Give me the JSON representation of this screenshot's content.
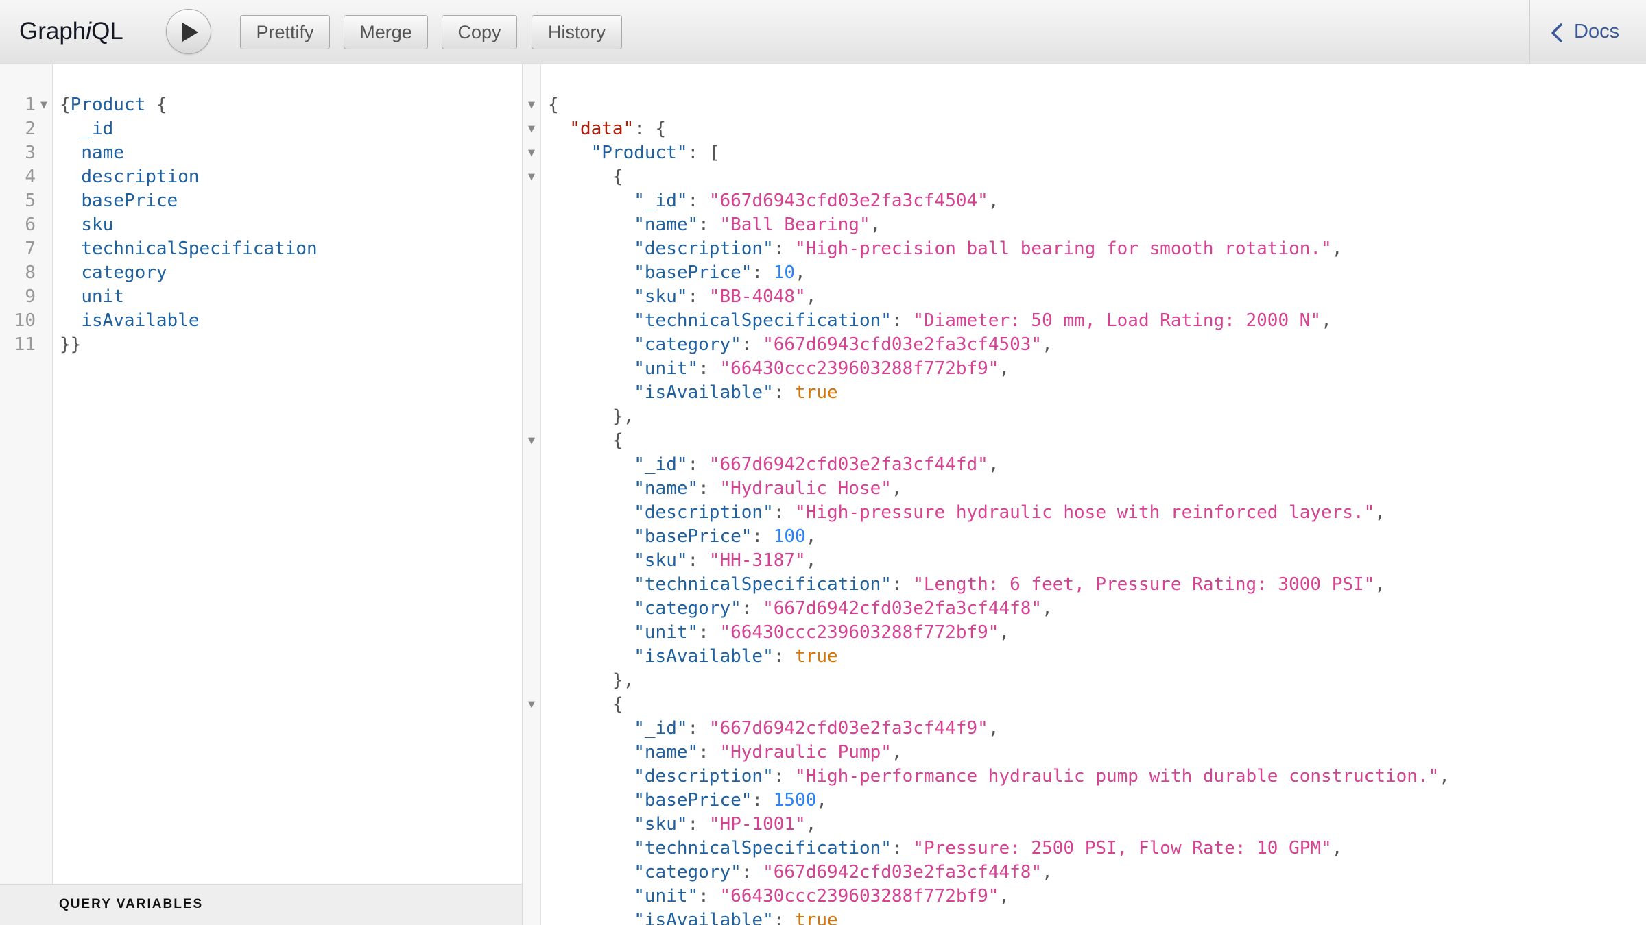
{
  "toolbar": {
    "logo_part1": "Graph",
    "logo_part2": "i",
    "logo_part3": "QL",
    "prettify": "Prettify",
    "merge": "Merge",
    "copy": "Copy",
    "history": "History",
    "docs": "Docs",
    "run_icon": "play-icon",
    "docs_icon": "chevron-left-icon"
  },
  "query_editor": {
    "line_numbers": [
      "1",
      "2",
      "3",
      "4",
      "5",
      "6",
      "7",
      "8",
      "9",
      "10",
      "11"
    ],
    "open_brace": "{",
    "type_name": "Product",
    "inner_brace": " {",
    "fields": [
      "_id",
      "name",
      "description",
      "basePrice",
      "sku",
      "technicalSpecification",
      "category",
      "unit",
      "isAvailable"
    ],
    "close": "}}"
  },
  "query_variables_label": "QUERY VARIABLES",
  "result": {
    "open": "{",
    "data_key": "\"data\"",
    "product_key": "\"Product\"",
    "products": [
      {
        "_id": "\"667d6943cfd03e2fa3cf4504\"",
        "name": "\"Ball Bearing\"",
        "description": "\"High-precision ball bearing for smooth rotation.\"",
        "basePrice": "10",
        "sku": "\"BB-4048\"",
        "technicalSpecification": "\"Diameter: 50 mm, Load Rating: 2000 N\"",
        "category": "\"667d6943cfd03e2fa3cf4503\"",
        "unit": "\"66430ccc239603288f772bf9\"",
        "isAvailable": "true"
      },
      {
        "_id": "\"667d6942cfd03e2fa3cf44fd\"",
        "name": "\"Hydraulic Hose\"",
        "description": "\"High-pressure hydraulic hose with reinforced layers.\"",
        "basePrice": "100",
        "sku": "\"HH-3187\"",
        "technicalSpecification": "\"Length: 6 feet, Pressure Rating: 3000 PSI\"",
        "category": "\"667d6942cfd03e2fa3cf44f8\"",
        "unit": "\"66430ccc239603288f772bf9\"",
        "isAvailable": "true"
      },
      {
        "_id": "\"667d6942cfd03e2fa3cf44f9\"",
        "name": "\"Hydraulic Pump\"",
        "description": "\"High-performance hydraulic pump with durable construction.\"",
        "basePrice": "1500",
        "sku": "\"HP-1001\"",
        "technicalSpecification": "\"Pressure: 2500 PSI, Flow Rate: 10 GPM\"",
        "category": "\"667d6942cfd03e2fa3cf44f8\"",
        "unit": "\"66430ccc239603288f772bf9\"",
        "isAvailable": "true"
      }
    ]
  },
  "colors": {
    "key": "#1f61a0",
    "string": "#d64292",
    "number": "#2882f9",
    "boolean": "#d47509",
    "data_key": "#b11a04",
    "docs_link": "#3b5998"
  }
}
